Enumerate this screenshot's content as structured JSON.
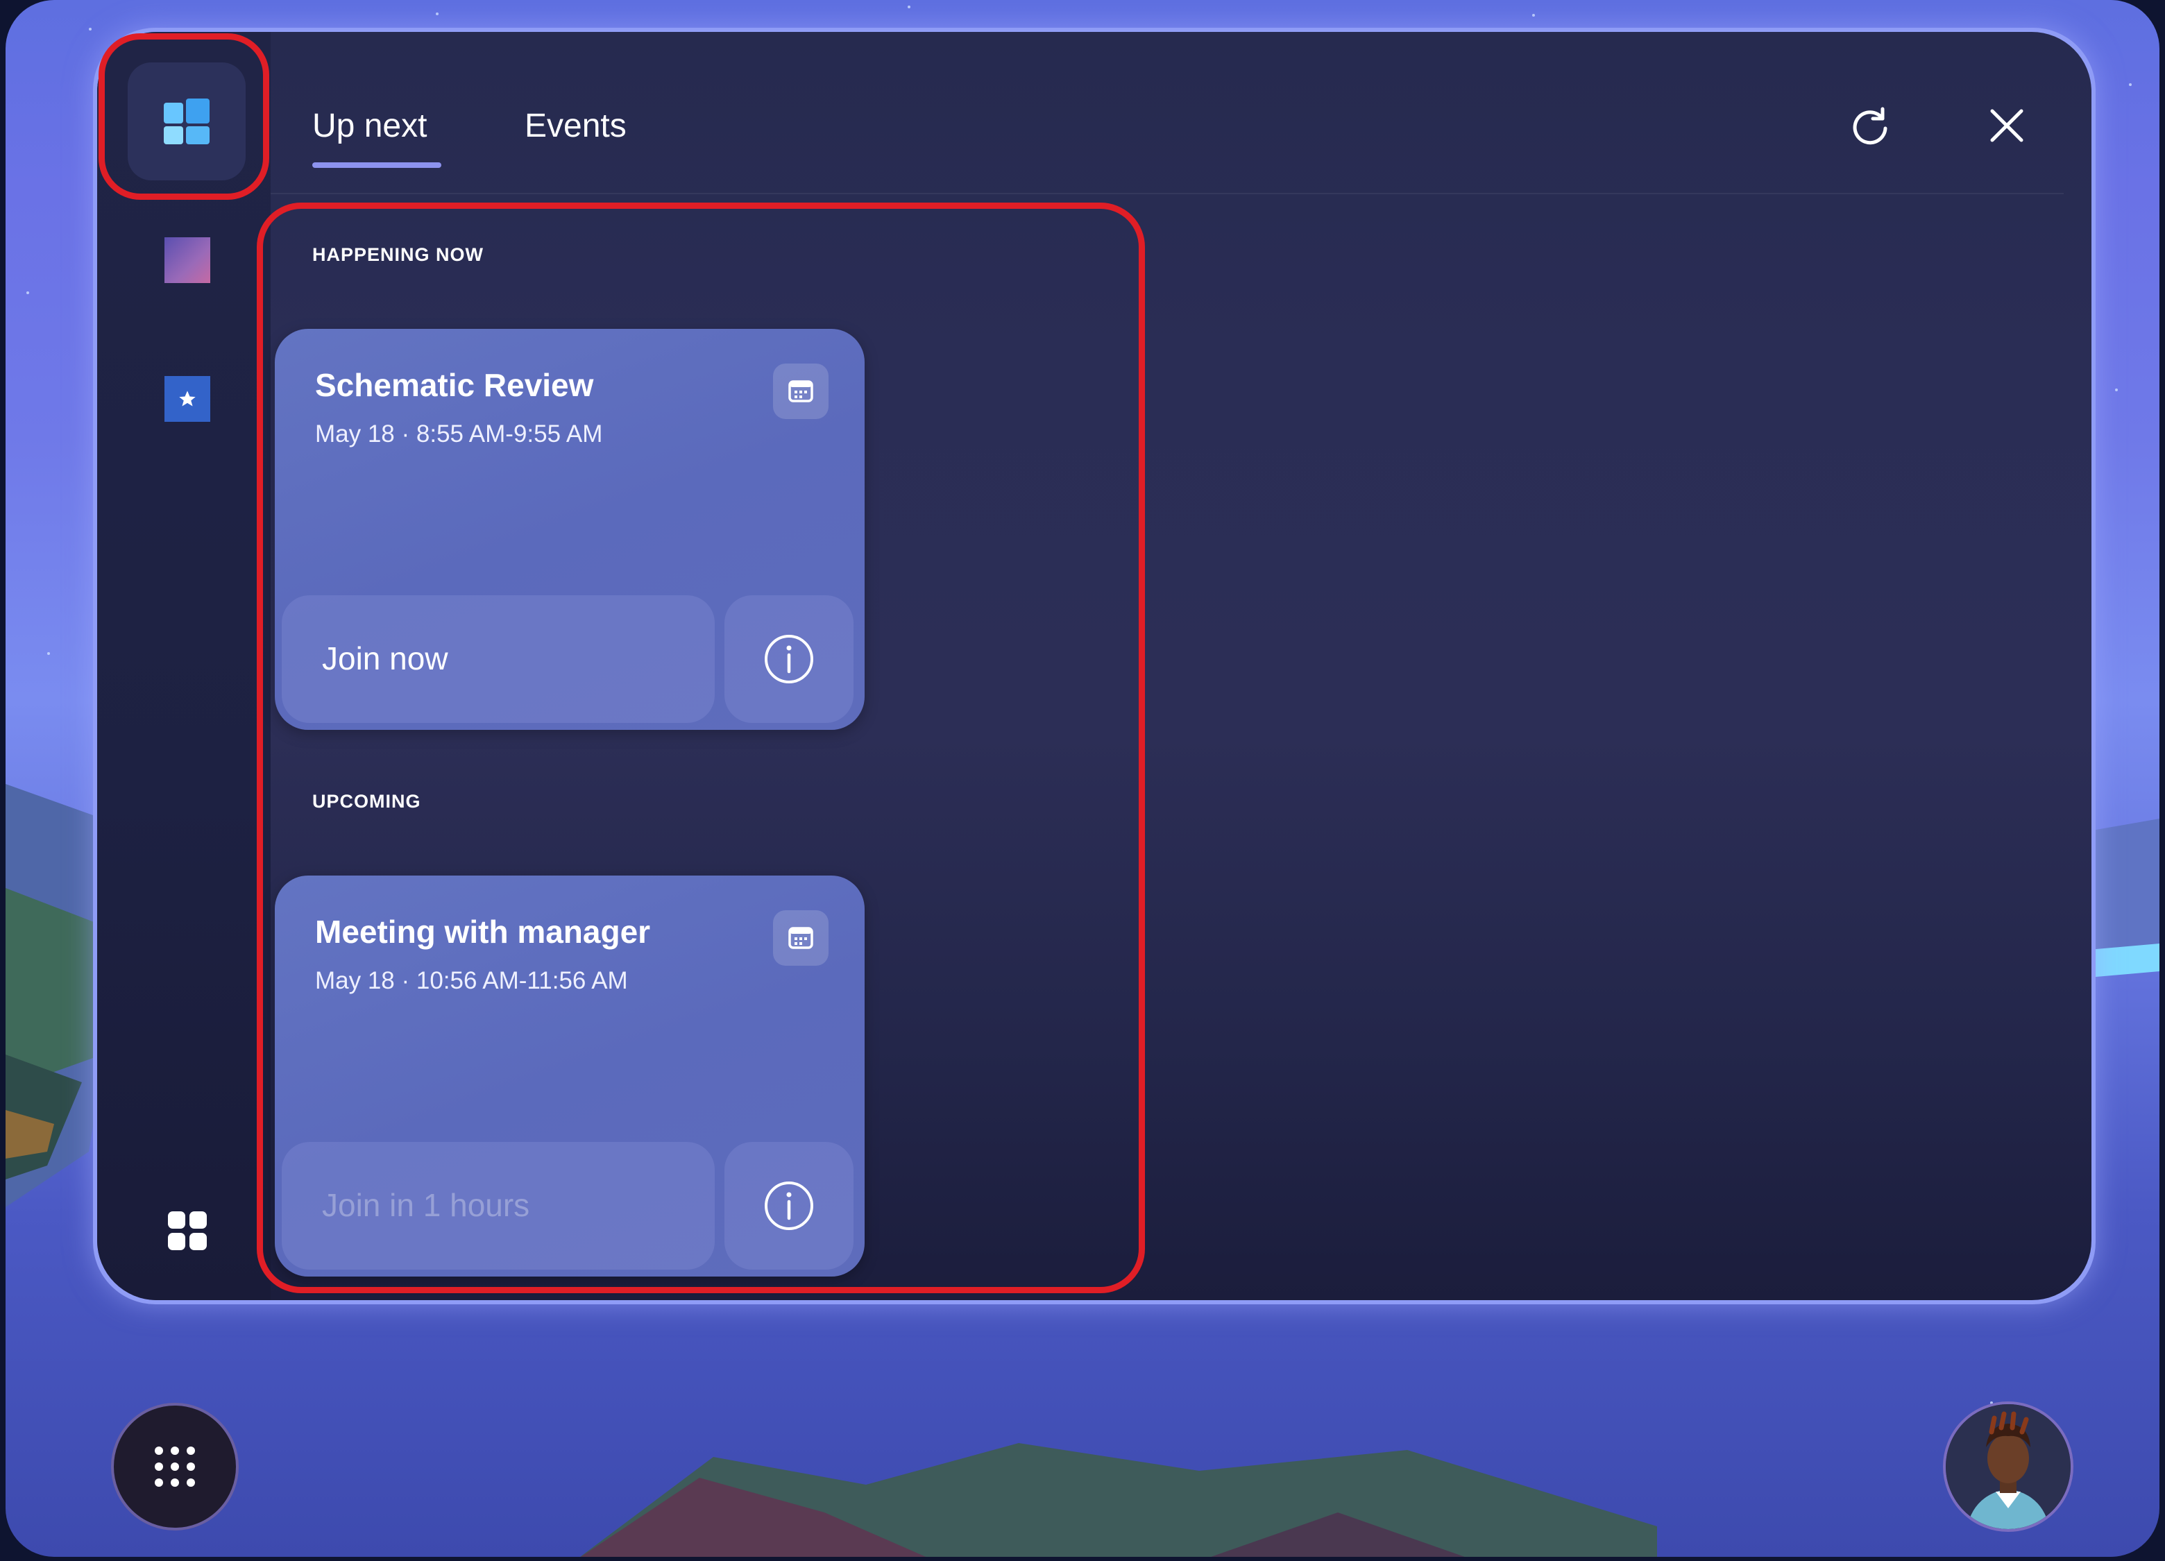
{
  "tabs": [
    {
      "label": "Up next",
      "active": true
    },
    {
      "label": "Events",
      "active": false
    }
  ],
  "sections": {
    "happening_now": "HAPPENING NOW",
    "upcoming": "UPCOMING"
  },
  "cards": [
    {
      "title": "Schematic Review",
      "time": "May 18 · 8:55 AM-9:55 AM",
      "join_label": "Join now",
      "join_enabled": true
    },
    {
      "title": "Meeting with manager",
      "time": "May 18 · 10:56 AM-11:56 AM",
      "join_label": "Join in 1 hours",
      "join_enabled": false
    }
  ],
  "icons": {
    "home": "windows-grid-icon",
    "refresh": "refresh-icon",
    "close": "close-icon",
    "calendar": "calendar-icon",
    "info": "info-icon",
    "apps": "apps-grid-icon",
    "launcher": "dots-grid-icon"
  },
  "colors": {
    "highlight": "#e01e26",
    "tab_underline": "#8d93ef",
    "card_background": "#5e6cbc",
    "panel_background": "#2a2d55"
  }
}
